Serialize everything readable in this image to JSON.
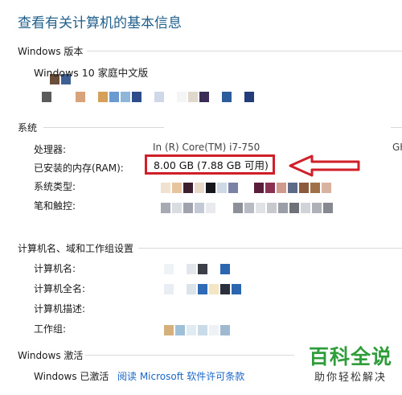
{
  "page": {
    "title": "查看有关计算机的基本信息"
  },
  "windows_edition": {
    "heading": "Windows 版本",
    "edition_name": "Windows 10 家庭中文版",
    "edition_prefix_mosaic": [
      "#6b4e3a",
      "#3d5f91"
    ],
    "copyright_mosaic": [
      "#5b5b5b",
      "#ffffff",
      "#ffffff",
      "#d8a27a",
      "#ffffff",
      "#d4a05a",
      "#6a9ad0",
      "#8fb5d8",
      "#2c4d8a",
      "#ffffff",
      "#cfd8e6",
      "#ffffff",
      "#f5f5f5",
      "#e0d8cc",
      "#3b2c57",
      "#ffffff",
      "#2d5c9c",
      "#ffffff",
      "#233c7a"
    ]
  },
  "system": {
    "heading": "系统",
    "processor_label": "处理器:",
    "processor_value_visible": "In      (R) Core(TM) i7-750",
    "processor_tail": "GH",
    "ram_label": "已安装的内存(RAM):",
    "ram_value": "8.00 GB (7.88 GB 可用)",
    "system_type_label": "系统类型:",
    "system_type_mosaic": [
      "#f0e2cf",
      "#e6c49c",
      "#3c1f2f",
      "#e6d9c8",
      "#15171c",
      "#cfd9e6",
      "#7a82a5"
    ],
    "system_type_mosaic2": [
      "#5a1d3c",
      "#8a3050",
      "#cf9a8c",
      "#5e6b87",
      "#8c5a3c",
      "#a07048",
      "#d9b3a0"
    ],
    "pen_touch_label": "笔和触控:",
    "pen_touch_mosaic": [
      "#a7aab3",
      "#d9dde2",
      "#9ea3ae",
      "#c3cad6",
      "#e8eaee"
    ],
    "pen_touch_mosaic2": [
      "#8d9098",
      "#b7bbc4",
      "#e0e2e6",
      "#c7c9ce",
      "#9a9ea6",
      "#707279",
      "#d0d3d8",
      "#aeb1b8",
      "#868990"
    ],
    "arrow_color": "#d11f2a"
  },
  "computer": {
    "heading": "计算机名、域和工作组设置",
    "name_label": "计算机名:",
    "name_mosaic": [
      "#eef3f6",
      "#ffffff",
      "#e3e6ea",
      "#3c3f48",
      "#ffffff",
      "#2c66b0"
    ],
    "fullname_label": "计算机全名:",
    "fullname_mosaic": [
      "#e8eef3",
      "#ffffff",
      "#dde3ea",
      "#2f6ab6",
      "#f3e6c4",
      "#2a2f3c",
      "#2c66b0"
    ],
    "description_label": "计算机描述:",
    "workgroup_label": "工作组:",
    "workgroup_mosaic": [
      "#d4b07a",
      "#a0c0d8",
      "#e1ecf2",
      "#c9dbe6",
      "#eef2f4",
      "#9fbad0"
    ]
  },
  "activation": {
    "heading": "Windows 激活",
    "status": "Windows 已激活",
    "license_link": "阅读 Microsoft 软件许可条款"
  },
  "watermark": {
    "main": "百科全说",
    "sub": "助你轻松解决"
  }
}
